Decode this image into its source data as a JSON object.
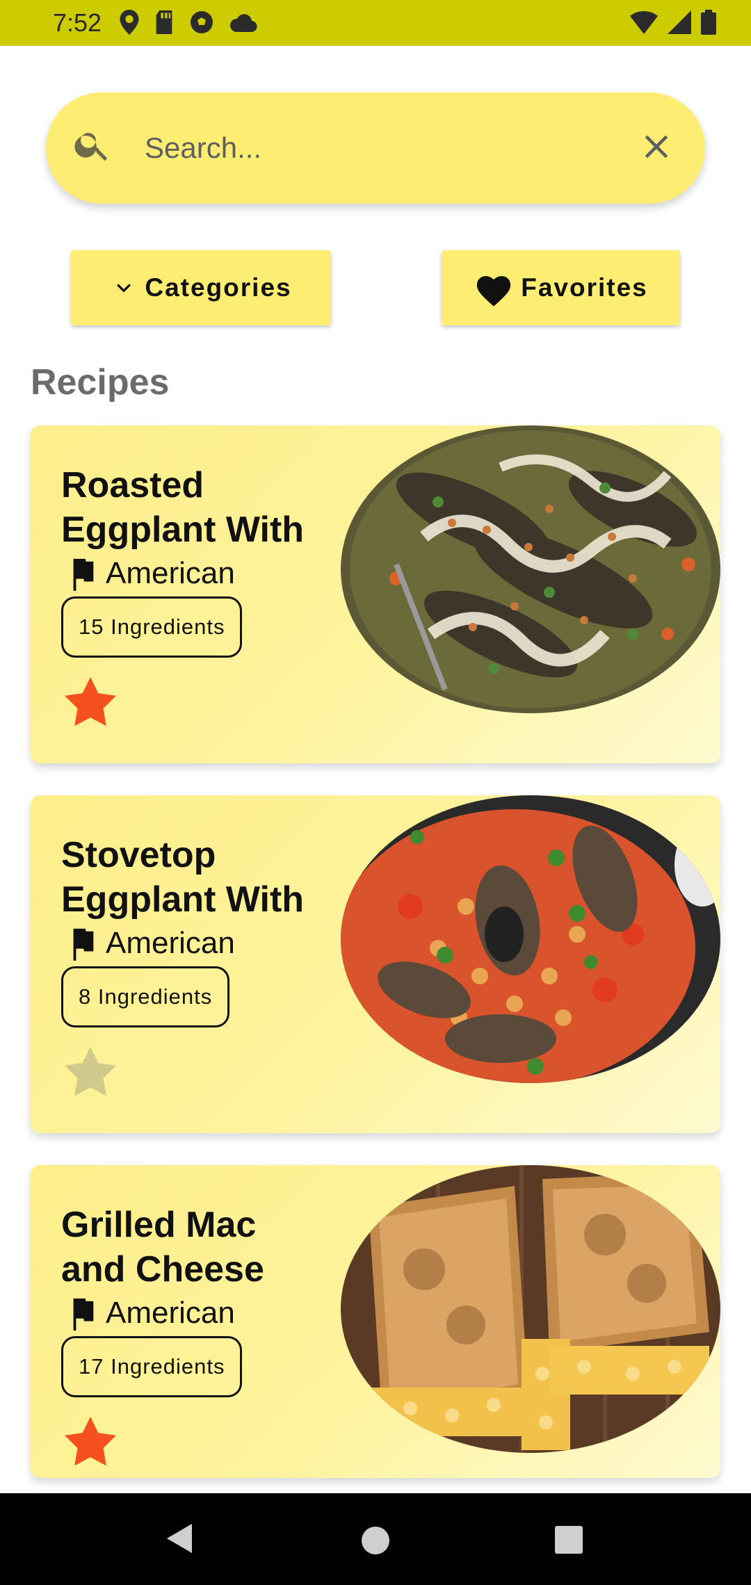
{
  "status_bar": {
    "time": "7:52",
    "left_icons": [
      "location-icon",
      "sd-card-icon",
      "soccer-icon",
      "cloud-icon"
    ],
    "right_icons": [
      "wifi-icon",
      "signal-icon",
      "battery-icon"
    ],
    "color": "#cccc00"
  },
  "search": {
    "placeholder": "Search...",
    "value": ""
  },
  "buttons": {
    "categories_label": "Categories",
    "favorites_label": "Favorites"
  },
  "section": {
    "title": "Recipes"
  },
  "recipes": [
    {
      "title": "Roasted\nEggplant With",
      "cuisine": "American",
      "ingredients": "15 Ingredients",
      "favorite": true,
      "image": "roasted eggplant with sauce and pine nuts"
    },
    {
      "title": "Stovetop\nEggplant With",
      "cuisine": "American",
      "ingredients": "8 Ingredients",
      "favorite": false,
      "image": "stovetop eggplant with chickpeas and tomatoes"
    },
    {
      "title": "Grilled Mac\nand Cheese",
      "cuisine": "American",
      "ingredients": "17 Ingredients",
      "favorite": true,
      "image": "grilled mac and cheese sandwich"
    }
  ],
  "colors": {
    "accent_yellow": "#fdee73",
    "star_active": "#f4511e",
    "star_inactive": "#cfc98a"
  }
}
